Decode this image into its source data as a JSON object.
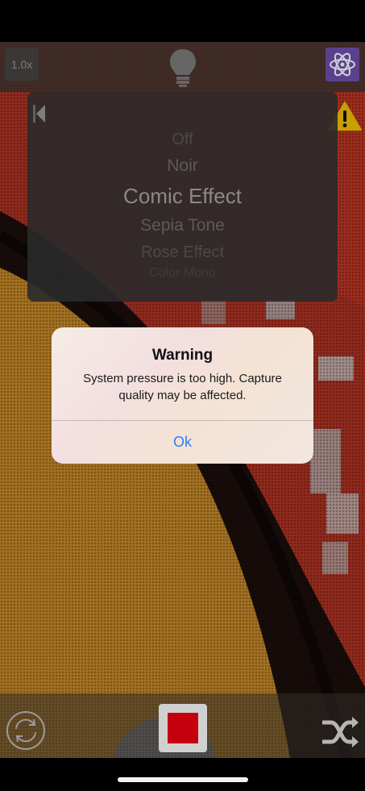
{
  "camera": {
    "zoom_label": "1.0x"
  },
  "filters": {
    "items": [
      "Off",
      "Noir",
      "Comic Effect",
      "Sepia Tone",
      "Rose Effect",
      "Color Mono"
    ],
    "selected": "Comic Effect"
  },
  "alert": {
    "title": "Warning",
    "message": "System pressure is too high. Capture quality may be affected.",
    "ok_label": "Ok"
  },
  "colors": {
    "accent_purple": "#6f4fb0",
    "record_red": "#c4000f",
    "alert_button_blue": "#2f7cf6",
    "warning_yellow": "#f3c300"
  },
  "icons": {
    "flashlight": "lightbulb-icon",
    "effects": "atom-icon",
    "warning": "warning-icon",
    "back": "back-arrow-icon",
    "switch_camera": "switch-camera-icon",
    "record": "record-stop-icon",
    "shuffle": "shuffle-icon"
  }
}
